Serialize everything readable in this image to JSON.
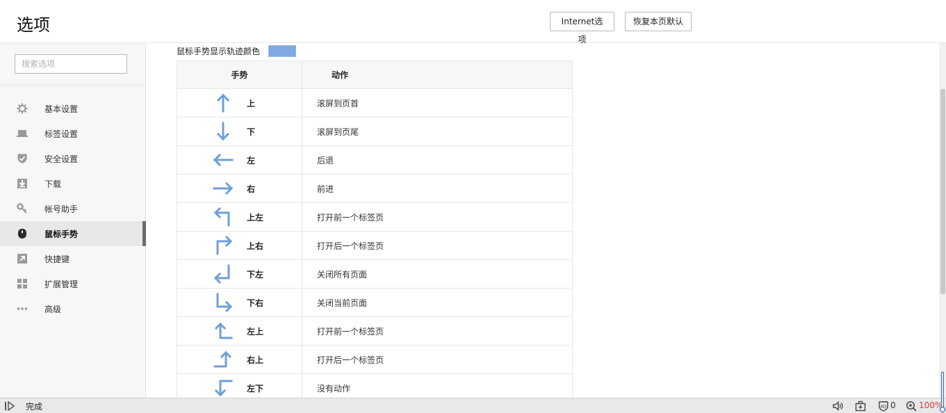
{
  "header": {
    "title": "选项",
    "buttons": {
      "internet_options": "Internet选项",
      "restore_defaults": "恢复本页默认"
    }
  },
  "sidebar": {
    "search": {
      "placeholder": "搜索选项",
      "value": ""
    },
    "items": [
      {
        "label": "基本设置",
        "icon": "gear-icon",
        "active": false
      },
      {
        "label": "标签设置",
        "icon": "tab-icon",
        "active": false
      },
      {
        "label": "安全设置",
        "icon": "shield-icon",
        "active": false
      },
      {
        "label": "下载",
        "icon": "download-icon",
        "active": false
      },
      {
        "label": "帐号助手",
        "icon": "key-icon",
        "active": false
      },
      {
        "label": "鼠标手势",
        "icon": "mouse-icon",
        "active": true
      },
      {
        "label": "快捷键",
        "icon": "shortcut-icon",
        "active": false
      },
      {
        "label": "扩展管理",
        "icon": "grid-icon",
        "active": false
      },
      {
        "label": "高级",
        "icon": "more-icon",
        "active": false
      }
    ]
  },
  "gestures": {
    "trail_color_label": "鼠标手势显示轨迹颜色",
    "trail_color": "#7fa9e4",
    "columns": {
      "gesture": "手势",
      "action": "动作"
    },
    "rows": [
      {
        "gesture": "上",
        "action": "滚屏到页首",
        "icon": "arrow-up-icon"
      },
      {
        "gesture": "下",
        "action": "滚屏到页尾",
        "icon": "arrow-down-icon"
      },
      {
        "gesture": "左",
        "action": "后退",
        "icon": "arrow-left-icon"
      },
      {
        "gesture": "右",
        "action": "前进",
        "icon": "arrow-right-icon"
      },
      {
        "gesture": "上左",
        "action": "打开前一个标签页",
        "icon": "arrow-up-left-icon"
      },
      {
        "gesture": "上右",
        "action": "打开后一个标签页",
        "icon": "arrow-up-right-icon"
      },
      {
        "gesture": "下左",
        "action": "关闭所有页面",
        "icon": "arrow-down-left-icon"
      },
      {
        "gesture": "下右",
        "action": "关闭当前页面",
        "icon": "arrow-down-right-icon"
      },
      {
        "gesture": "左上",
        "action": "打开前一个标签页",
        "icon": "arrow-left-up-icon"
      },
      {
        "gesture": "右上",
        "action": "打开后一个标签页",
        "icon": "arrow-right-up-icon"
      },
      {
        "gesture": "左下",
        "action": "没有动作",
        "icon": "arrow-left-down-icon"
      }
    ]
  },
  "statusbar": {
    "status": "完成",
    "blocked_count": "0",
    "zoom": "100%"
  },
  "colors": {
    "accent_arrow": "#6f9fd8",
    "zoom_text": "#dd3333"
  }
}
